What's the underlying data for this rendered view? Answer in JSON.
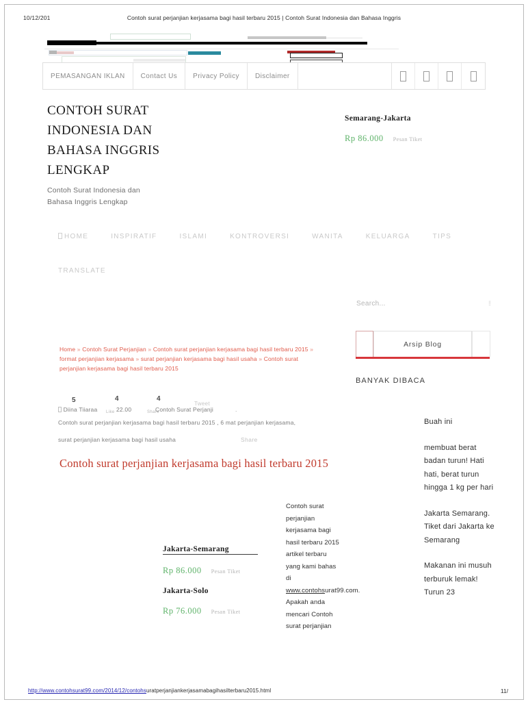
{
  "print": {
    "date": "10/12/201",
    "header_title": "Contoh surat perjanjian kerjasama bagi hasil terbaru 2015 | Contoh Surat Indonesia dan Bahasa Inggris",
    "footer_url_link": "http://www.contohsurat99.com/2014/12/contohs",
    "footer_url_rest": "uratperjanjiankerjasamabagihasilterbaru2015.html",
    "page_number": "11/"
  },
  "topmenu": {
    "items": [
      {
        "label": "PEMASANGAN IKLAN"
      },
      {
        "label": "Contact Us"
      },
      {
        "label": "Privacy Policy"
      },
      {
        "label": "Disclaimer"
      }
    ],
    "icons": [
      "social-icon-1",
      "social-icon-2",
      "social-icon-3",
      "social-icon-4"
    ]
  },
  "masthead": {
    "title_lines": [
      "CONTOH SURAT",
      "INDONESIA DAN",
      "BAHASA INGGRIS",
      "LENGKAP"
    ],
    "tagline_lines": [
      "Contoh Surat Indonesia dan",
      "Bahasa Inggris Lengkap"
    ]
  },
  "header_ad": {
    "route": "Semarang-Jakarta",
    "price": "Rp 86.000",
    "cta": "Pesan Tiket"
  },
  "nav": {
    "row1": [
      "HOME",
      "INSPIRATIF",
      "ISLAMI",
      "KONTROVERSI",
      "WANITA",
      "KELUARGA",
      "TIPS"
    ],
    "row2": [
      "TRANSLATE"
    ]
  },
  "sidebar": {
    "search_placeholder": "Search...",
    "search_icon": "search-icon",
    "arsip_tab_label": "Arsip Blog",
    "popular_heading": "BANYAK DIBACA",
    "popular_items": [
      "Buah ini",
      "membuat berat badan turun! Hati hati, berat turun hingga 1 kg per hari",
      "Jakarta Semarang. Tiket dari Jakarta ke Semarang",
      "Makanan ini musuh terburuk lemak! Turun 23"
    ]
  },
  "breadcrumb": {
    "items": [
      "Home",
      "Contoh Surat Perjanjian",
      "Contoh surat perjanjian kerjasama bagi hasil terbaru",
      "2015",
      "format perjanjian kerjasama",
      "surat perjanjian kerjasama bagi hasil usaha",
      "Contoh surat perjanjian kerjasama bagi hasil terbaru 2015"
    ],
    "separator": "»"
  },
  "byline": {
    "author": "Diina Tiiaraa",
    "time": "22.00",
    "like_count": "5",
    "like_label": "Like",
    "share_count": "4",
    "share_label": "Share",
    "second_count": "4",
    "tweet_label": "Tweet",
    "overlap_text": "Contoh Surat Perjanji",
    "trailing_dot": ".",
    "line2": "Contoh surat perjanjian kerjasama bagi hasil terbaru 2015 , 6 mat perjanjian kerjasama,",
    "line3": "surat perjanjian kerjasama bagi hasil usaha",
    "share_right_label": "Share"
  },
  "post": {
    "title": "Contoh surat perjanjian kerjasama bagi hasil terbaru 2015",
    "body_before_link": "Contoh surat perjanjian kerjasama bagi hasil terbaru 2015 artikel terbaru yang kami bahas di ",
    "body_link": "www.contohs",
    "body_after_link": "urat99.com. Apakah anda mencari Contoh surat perjanjian"
  },
  "inline_ad": {
    "route1": "Jakarta-Semarang",
    "price1": "Rp 86.000",
    "cta1": "Pesan Tiket",
    "route2": "Jakarta-Solo",
    "price2": "Rp 76.000",
    "cta2": "Pesan Tiket"
  },
  "colors": {
    "accent_red": "#d7363b",
    "price_green": "#5fb36a",
    "title_red": "#c0392b",
    "crumb_red": "#e05a4a",
    "link_blue": "#2424b0"
  }
}
